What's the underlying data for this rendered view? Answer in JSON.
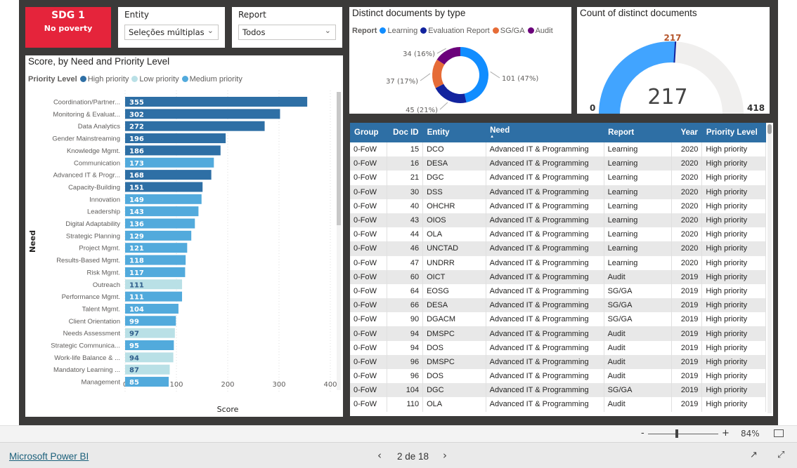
{
  "sdg": {
    "title": "SDG 1",
    "subtitle": "No poverty",
    "color": "#e5243b"
  },
  "slicers": [
    {
      "label": "Entity",
      "value": "Seleções múltiplas"
    },
    {
      "label": "Report",
      "value": "Todos"
    }
  ],
  "bar_chart": {
    "title": "Score, by Need and Priority Level",
    "legend_title": "Priority Level",
    "legend": [
      {
        "name": "High priority",
        "color": "#2e6fa5"
      },
      {
        "name": "Low priority",
        "color": "#b9e0e6"
      },
      {
        "name": "Medium priority",
        "color": "#52aadc"
      }
    ]
  },
  "chart_data": [
    {
      "type": "bar",
      "orientation": "horizontal",
      "title": "Score, by Need and Priority Level",
      "xlabel": "Score",
      "ylabel": "Need",
      "xlim": [
        0,
        400
      ],
      "xticks": [
        0,
        100,
        200,
        300,
        400
      ],
      "grid": true,
      "legend_position": "top-left",
      "categories": [
        "Coordination/Partner...",
        "Monitoring & Evaluat...",
        "Data Analytics",
        "Gender Mainstreaming",
        "Knowledge Mgmt.",
        "Communication",
        "Advanced IT & Progr...",
        "Capacity-Building",
        "Innovation",
        "Leadership",
        "Digital Adaptability",
        "Strategic Planning",
        "Project Mgmt.",
        "Results-Based Mgmt.",
        "Risk Mgmt.",
        "Outreach",
        "Performance Mgmt.",
        "Talent Mgmt.",
        "Client Orientation",
        "Needs Assessment",
        "Strategic Communica...",
        "Work-life Balance & ...",
        "Mandatory Learning ...",
        "Management"
      ],
      "values": [
        355,
        302,
        272,
        196,
        186,
        173,
        168,
        151,
        149,
        143,
        136,
        129,
        121,
        118,
        117,
        111,
        111,
        104,
        99,
        97,
        95,
        94,
        87,
        85
      ],
      "priority": [
        "High priority",
        "High priority",
        "High priority",
        "High priority",
        "High priority",
        "Medium priority",
        "High priority",
        "High priority",
        "Medium priority",
        "Medium priority",
        "Medium priority",
        "Medium priority",
        "Medium priority",
        "Medium priority",
        "Medium priority",
        "Low priority",
        "Medium priority",
        "Medium priority",
        "Medium priority",
        "Low priority",
        "Medium priority",
        "Low priority",
        "Low priority",
        "Medium priority"
      ]
    },
    {
      "type": "pie",
      "variant": "donut",
      "title": "Distinct documents by type",
      "legend_title": "Report",
      "legend_position": "top",
      "categories": [
        "Learning",
        "Evaluation Report",
        "SG/GA",
        "Audit"
      ],
      "values": [
        101,
        45,
        37,
        34
      ],
      "labels": [
        "101 (47%)",
        "45 (21%)",
        "37 (17%)",
        "34 (16%)"
      ],
      "colors": [
        "#118dff",
        "#12239e",
        "#e66c37",
        "#6b007b"
      ]
    },
    {
      "type": "gauge",
      "title": "Count of distinct documents",
      "value": 217,
      "min": 0,
      "max": 418,
      "target": 217,
      "value_label": "217",
      "min_label": "0",
      "max_label": "418",
      "target_label": "217"
    }
  ],
  "table": {
    "columns": [
      "Group",
      "Doc ID",
      "Entity",
      "Need",
      "Report",
      "Year",
      "Priority Level"
    ],
    "rows": [
      [
        "0-FoW",
        "15",
        "DCO",
        "Advanced IT & Programming",
        "Learning",
        "2020",
        "High priority"
      ],
      [
        "0-FoW",
        "16",
        "DESA",
        "Advanced IT & Programming",
        "Learning",
        "2020",
        "High priority"
      ],
      [
        "0-FoW",
        "21",
        "DGC",
        "Advanced IT & Programming",
        "Learning",
        "2020",
        "High priority"
      ],
      [
        "0-FoW",
        "30",
        "DSS",
        "Advanced IT & Programming",
        "Learning",
        "2020",
        "High priority"
      ],
      [
        "0-FoW",
        "40",
        "OHCHR",
        "Advanced IT & Programming",
        "Learning",
        "2020",
        "High priority"
      ],
      [
        "0-FoW",
        "43",
        "OIOS",
        "Advanced IT & Programming",
        "Learning",
        "2020",
        "High priority"
      ],
      [
        "0-FoW",
        "44",
        "OLA",
        "Advanced IT & Programming",
        "Learning",
        "2020",
        "High priority"
      ],
      [
        "0-FoW",
        "46",
        "UNCTAD",
        "Advanced IT & Programming",
        "Learning",
        "2020",
        "High priority"
      ],
      [
        "0-FoW",
        "47",
        "UNDRR",
        "Advanced IT & Programming",
        "Learning",
        "2020",
        "High priority"
      ],
      [
        "0-FoW",
        "60",
        "OICT",
        "Advanced IT & Programming",
        "Audit",
        "2019",
        "High priority"
      ],
      [
        "0-FoW",
        "64",
        "EOSG",
        "Advanced IT & Programming",
        "SG/GA",
        "2019",
        "High priority"
      ],
      [
        "0-FoW",
        "66",
        "DESA",
        "Advanced IT & Programming",
        "SG/GA",
        "2019",
        "High priority"
      ],
      [
        "0-FoW",
        "90",
        "DGACM",
        "Advanced IT & Programming",
        "SG/GA",
        "2019",
        "High priority"
      ],
      [
        "0-FoW",
        "94",
        "DMSPC",
        "Advanced IT & Programming",
        "Audit",
        "2019",
        "High priority"
      ],
      [
        "0-FoW",
        "94",
        "DOS",
        "Advanced IT & Programming",
        "Audit",
        "2019",
        "High priority"
      ],
      [
        "0-FoW",
        "96",
        "DMSPC",
        "Advanced IT & Programming",
        "Audit",
        "2019",
        "High priority"
      ],
      [
        "0-FoW",
        "96",
        "DOS",
        "Advanced IT & Programming",
        "Audit",
        "2019",
        "High priority"
      ],
      [
        "0-FoW",
        "104",
        "DGC",
        "Advanced IT & Programming",
        "SG/GA",
        "2019",
        "High priority"
      ],
      [
        "0-FoW",
        "110",
        "OLA",
        "Advanced IT & Programming",
        "Audit",
        "2019",
        "High priority"
      ]
    ]
  },
  "zoom": {
    "minus": "-",
    "plus": "+",
    "level": "84%",
    "slider_percent": 0.4
  },
  "footer": {
    "brand": "Microsoft Power BI",
    "page": "2 de 18"
  }
}
